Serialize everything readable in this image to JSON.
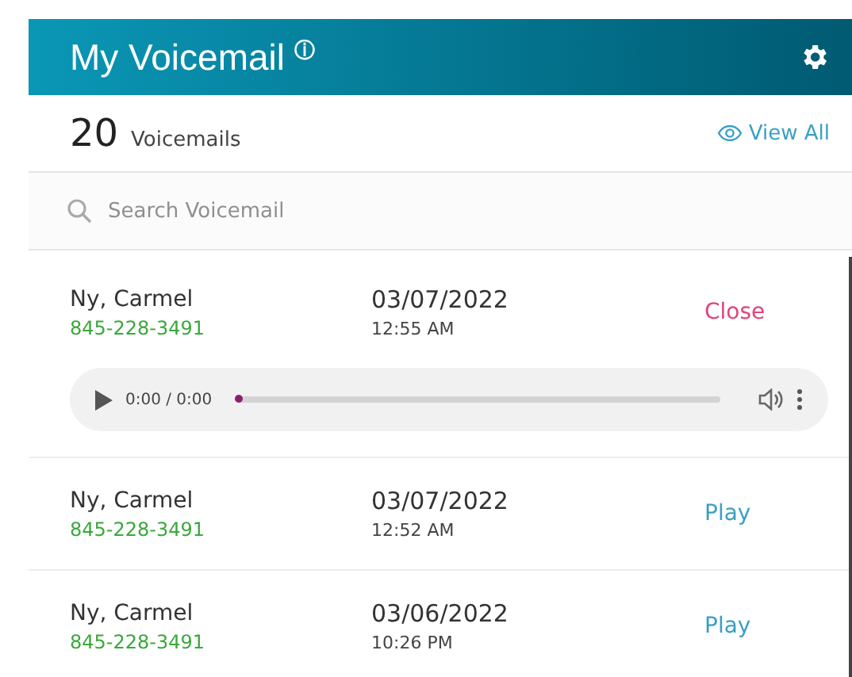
{
  "header": {
    "title": "My Voicemail",
    "info_icon": "ⓘ"
  },
  "summary": {
    "count": "20",
    "label": "Voicemails",
    "view_all": "View All"
  },
  "search": {
    "placeholder": "Search Voicemail"
  },
  "voicemails": [
    {
      "name": "Ny, Carmel",
      "number": "845-228-3491",
      "date": "03/07/2022",
      "time": "12:55 AM",
      "action": "Close",
      "expanded": true,
      "player": {
        "time": "0:00 / 0:00",
        "level": 0
      }
    },
    {
      "name": "Ny, Carmel",
      "number": "845-228-3491",
      "date": "03/07/2022",
      "time": "12:52 AM",
      "action": "Play",
      "expanded": false
    },
    {
      "name": "Ny, Carmel",
      "number": "845-228-3491",
      "date": "03/06/2022",
      "time": "10:26 PM",
      "action": "Play",
      "expanded": false
    }
  ]
}
